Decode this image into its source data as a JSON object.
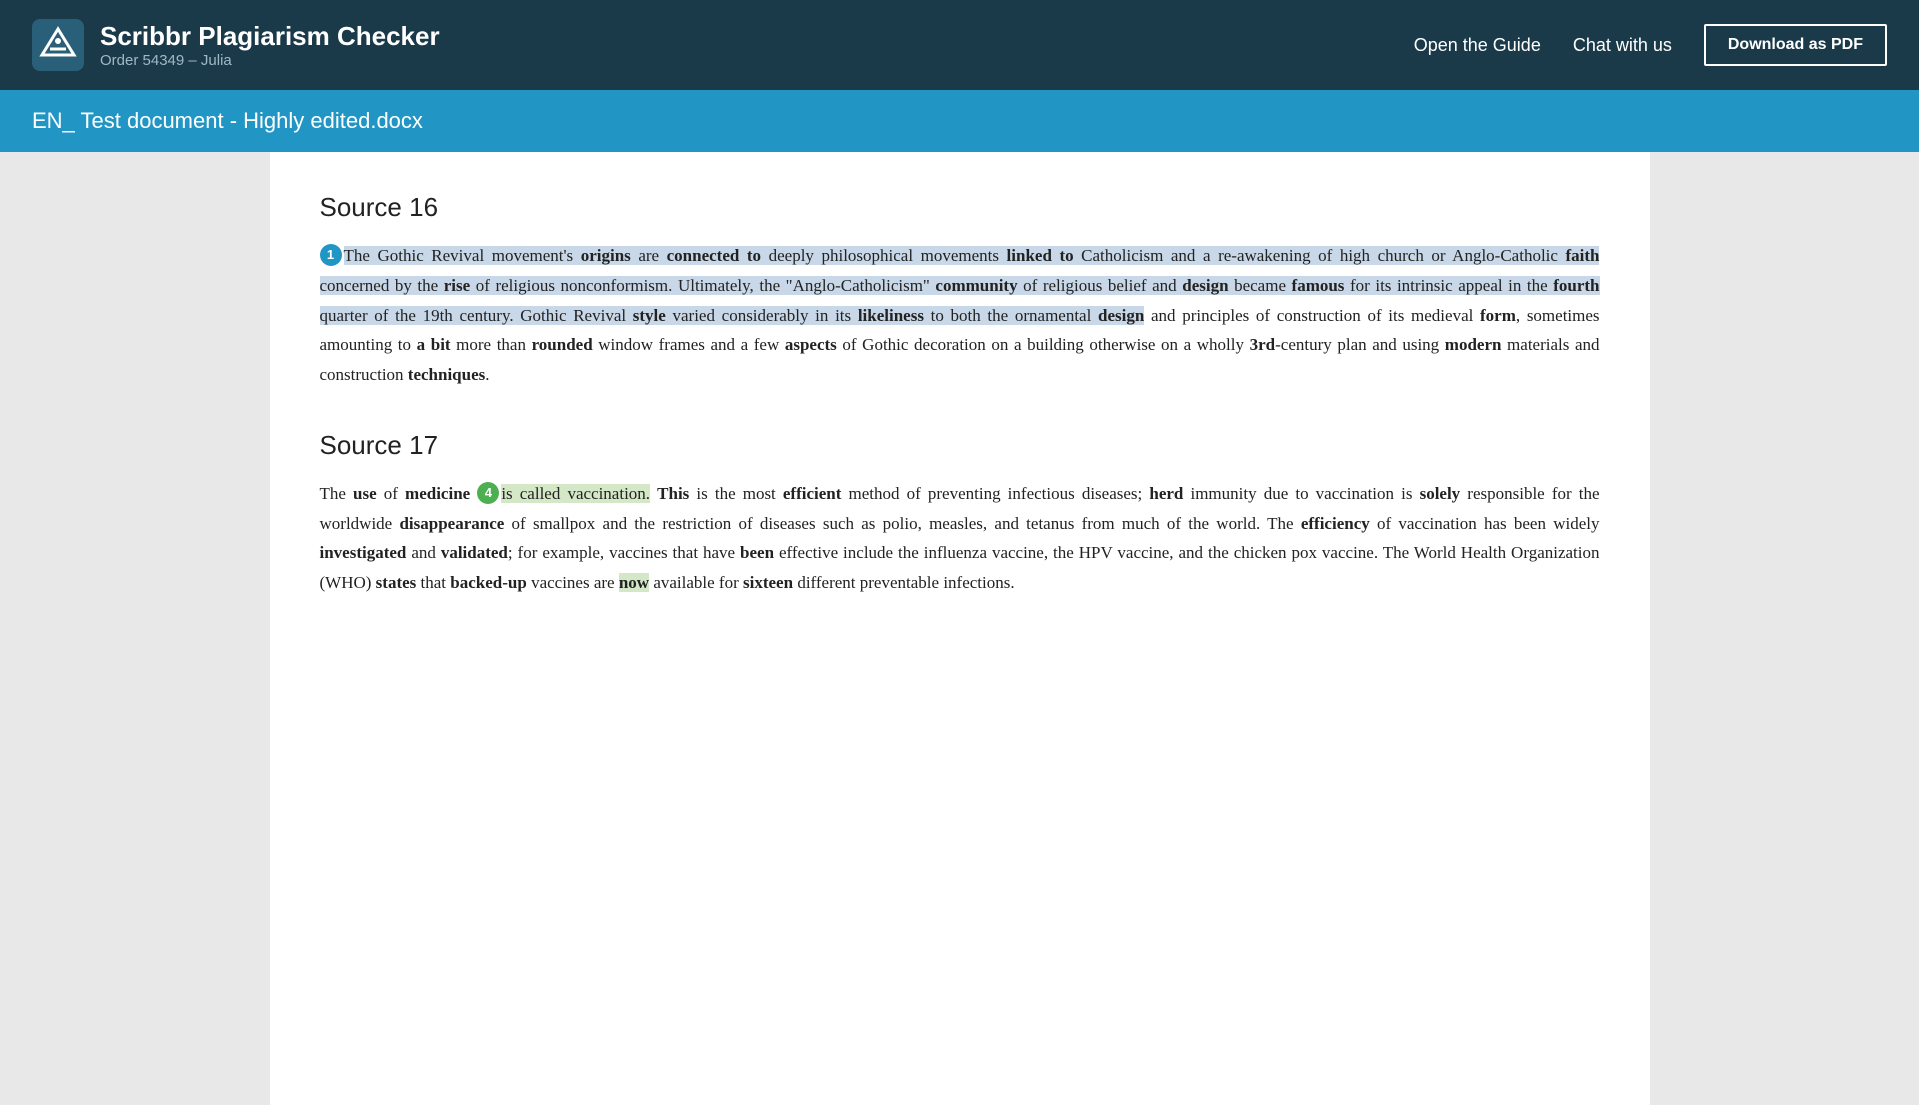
{
  "header": {
    "logo_alt": "Scribbr logo",
    "title": "Scribbr Plagiarism Checker",
    "subtitle": "Order 54349 – Julia",
    "nav": {
      "guide_label": "Open the Guide",
      "chat_label": "Chat with us",
      "download_label": "Download as PDF"
    }
  },
  "doc_title": "EN_ Test document - Highly edited.docx",
  "sources": [
    {
      "id": "source-16",
      "heading": "Source 16",
      "annotation": {
        "number": "1",
        "color": "blue"
      },
      "segments": [
        {
          "text": "The ",
          "bold": false,
          "highlight": "blue"
        },
        {
          "text": "Gothic Revival movement's ",
          "bold": false,
          "highlight": "blue"
        },
        {
          "text": "origins",
          "bold": true,
          "highlight": "blue"
        },
        {
          "text": " are ",
          "bold": false,
          "highlight": "blue"
        },
        {
          "text": "connected to",
          "bold": true,
          "highlight": "blue"
        },
        {
          "text": " deeply philosophical movements ",
          "bold": false,
          "highlight": "blue"
        },
        {
          "text": "linked to",
          "bold": true,
          "highlight": "blue"
        },
        {
          "text": " Catholicism and a re-awakening of high church or Anglo-Catholic ",
          "bold": false,
          "highlight": "blue"
        },
        {
          "text": "faith",
          "bold": true,
          "highlight": "blue"
        },
        {
          "text": " concerned by the ",
          "bold": false,
          "highlight": "blue"
        },
        {
          "text": "rise",
          "bold": true,
          "highlight": "blue"
        },
        {
          "text": " of religious nonconformism. Ultimately, the \"Anglo-Catholicism\" ",
          "bold": false,
          "highlight": "blue"
        },
        {
          "text": "community",
          "bold": true,
          "highlight": "blue"
        },
        {
          "text": " of religious belief and ",
          "bold": false,
          "highlight": "blue"
        },
        {
          "text": "design",
          "bold": true,
          "highlight": "blue"
        },
        {
          "text": " became ",
          "bold": false,
          "highlight": "blue"
        },
        {
          "text": "famous",
          "bold": true,
          "highlight": "blue"
        },
        {
          "text": " for its intrinsic appeal in the ",
          "bold": false,
          "highlight": "blue"
        },
        {
          "text": "fourth",
          "bold": true,
          "highlight": "blue"
        },
        {
          "text": " quarter of the 19th century. Gothic Revival ",
          "bold": false,
          "highlight": "blue"
        },
        {
          "text": "style",
          "bold": true,
          "highlight": "blue"
        },
        {
          "text": " varied considerably in its ",
          "bold": false,
          "highlight": "blue"
        },
        {
          "text": "likeliness",
          "bold": true,
          "highlight": "blue"
        },
        {
          "text": " to both the ornamental ",
          "bold": false,
          "highlight": "blue"
        },
        {
          "text": "design",
          "bold": true,
          "highlight": "blue"
        },
        {
          "text": " and principles of construction of its medieval ",
          "bold": false,
          "highlight": "none"
        },
        {
          "text": "form",
          "bold": true,
          "highlight": "none"
        },
        {
          "text": ", sometimes amounting to ",
          "bold": false,
          "highlight": "none"
        },
        {
          "text": "a bit",
          "bold": true,
          "highlight": "none"
        },
        {
          "text": " more than ",
          "bold": false,
          "highlight": "none"
        },
        {
          "text": "rounded",
          "bold": true,
          "highlight": "none"
        },
        {
          "text": " window frames and a few ",
          "bold": false,
          "highlight": "none"
        },
        {
          "text": "aspects",
          "bold": true,
          "highlight": "none"
        },
        {
          "text": " of Gothic decoration on a building otherwise on a wholly ",
          "bold": false,
          "highlight": "none"
        },
        {
          "text": "3rd",
          "bold": true,
          "highlight": "none"
        },
        {
          "text": "-century plan and using ",
          "bold": false,
          "highlight": "none"
        },
        {
          "text": "modern",
          "bold": true,
          "highlight": "none"
        },
        {
          "text": " materials and construction ",
          "bold": false,
          "highlight": "none"
        },
        {
          "text": "techniques",
          "bold": true,
          "highlight": "none"
        },
        {
          "text": ".",
          "bold": false,
          "highlight": "none"
        }
      ]
    },
    {
      "id": "source-17",
      "heading": "Source 17",
      "annotation": {
        "number": "4",
        "color": "green"
      },
      "segments": [
        {
          "text": "The ",
          "bold": false,
          "highlight": "none"
        },
        {
          "text": "use",
          "bold": true,
          "highlight": "none"
        },
        {
          "text": " of ",
          "bold": false,
          "highlight": "none"
        },
        {
          "text": "medicine",
          "bold": true,
          "highlight": "none"
        },
        {
          "text": " is called vaccination. ",
          "bold": false,
          "highlight": "yellow"
        },
        {
          "text": "This",
          "bold": true,
          "highlight": "none"
        },
        {
          "text": " is the most ",
          "bold": false,
          "highlight": "none"
        },
        {
          "text": "efficient",
          "bold": true,
          "highlight": "none"
        },
        {
          "text": " method of preventing infectious diseases; ",
          "bold": false,
          "highlight": "none"
        },
        {
          "text": "herd",
          "bold": true,
          "highlight": "none"
        },
        {
          "text": " immunity due to vaccination is ",
          "bold": false,
          "highlight": "none"
        },
        {
          "text": "solely",
          "bold": true,
          "highlight": "none"
        },
        {
          "text": " responsible for the worldwide ",
          "bold": false,
          "highlight": "none"
        },
        {
          "text": "disappearance",
          "bold": true,
          "highlight": "none"
        },
        {
          "text": " of smallpox and the restriction of diseases such as polio, measles, and tetanus from much of the world. The ",
          "bold": false,
          "highlight": "none"
        },
        {
          "text": "efficiency",
          "bold": true,
          "highlight": "none"
        },
        {
          "text": " of vaccination has been widely ",
          "bold": false,
          "highlight": "none"
        },
        {
          "text": "investigated",
          "bold": true,
          "highlight": "none"
        },
        {
          "text": " and ",
          "bold": false,
          "highlight": "none"
        },
        {
          "text": "validated",
          "bold": true,
          "highlight": "none"
        },
        {
          "text": "; for example, vaccines that have ",
          "bold": false,
          "highlight": "none"
        },
        {
          "text": "been",
          "bold": true,
          "highlight": "none"
        },
        {
          "text": " effective include the influenza vaccine, the HPV vaccine, and the chicken pox vaccine. The World Health Organization (WHO) ",
          "bold": false,
          "highlight": "none"
        },
        {
          "text": "states",
          "bold": true,
          "highlight": "none"
        },
        {
          "text": " that ",
          "bold": false,
          "highlight": "none"
        },
        {
          "text": "backed-up",
          "bold": true,
          "highlight": "none"
        },
        {
          "text": " vaccines are ",
          "bold": false,
          "highlight": "none"
        },
        {
          "text": "now",
          "bold": true,
          "highlight": "yellow"
        },
        {
          "text": " available for ",
          "bold": false,
          "highlight": "none"
        },
        {
          "text": "sixteen",
          "bold": true,
          "highlight": "none"
        },
        {
          "text": " different preventable infections.",
          "bold": false,
          "highlight": "none"
        }
      ]
    }
  ]
}
